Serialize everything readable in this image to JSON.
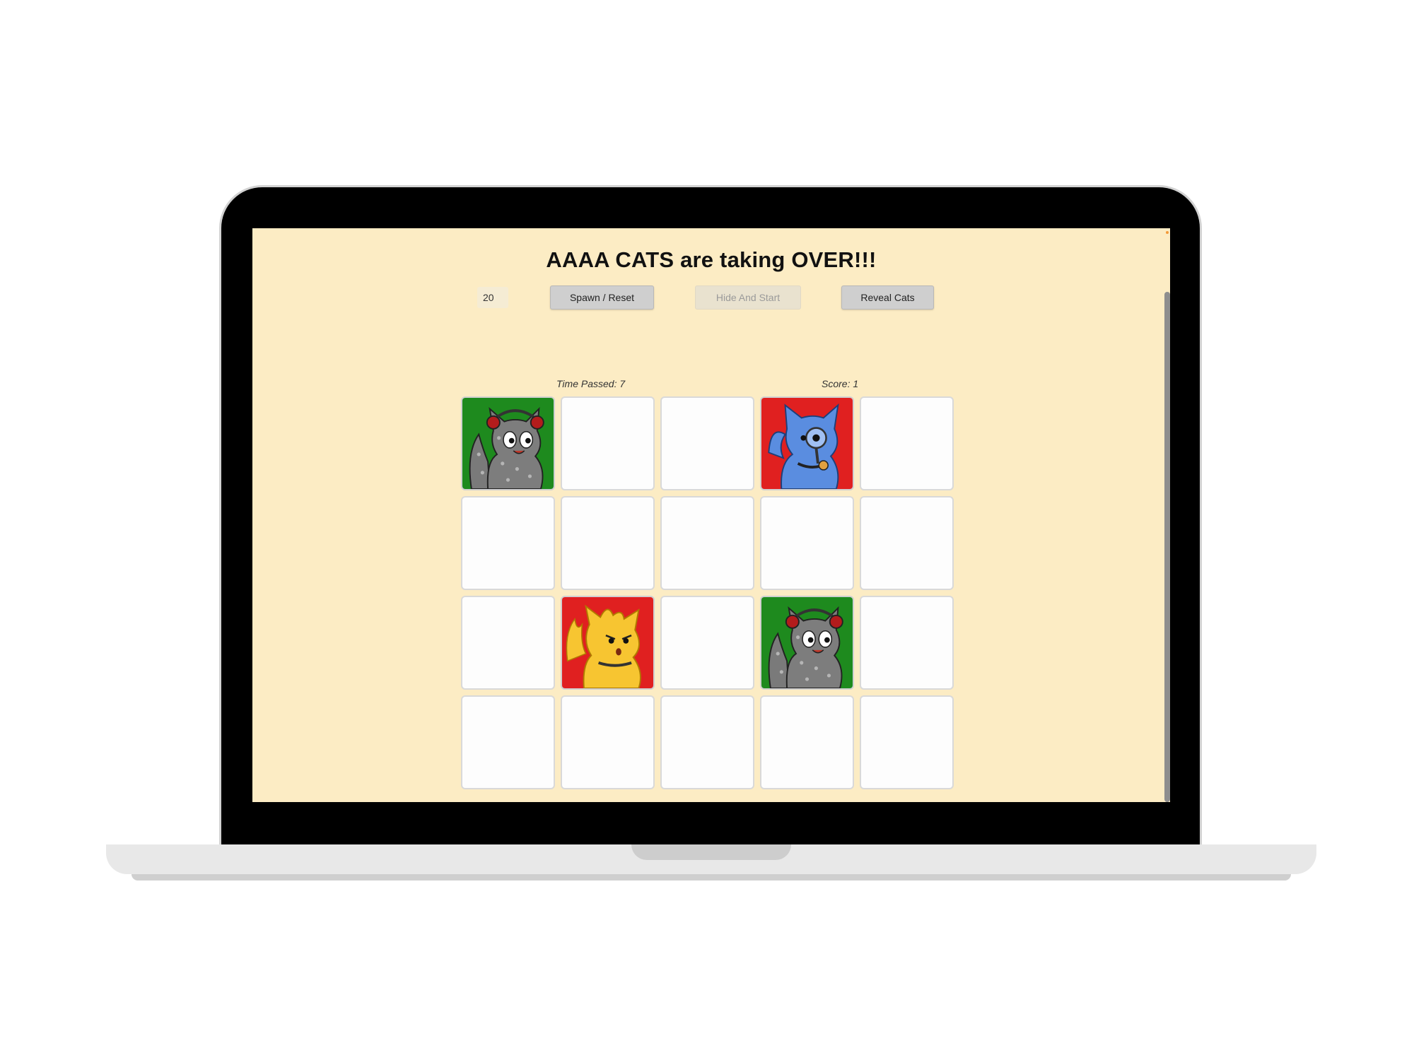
{
  "app": {
    "title": "AAAA CATS are taking OVER!!!",
    "count_value": "20",
    "buttons": {
      "spawn": "Spawn / Reset",
      "hide": "Hide And Start",
      "reveal": "Reveal Cats"
    },
    "time_label": "Time Passed: 7",
    "score_label": "Score: 1"
  },
  "grid": {
    "rows": 4,
    "cols": 5,
    "cells": [
      {
        "cat": "gray-headphones-cat",
        "bg": "#1e8a1e"
      },
      {
        "cat": null
      },
      {
        "cat": null
      },
      {
        "cat": "blue-magnifier-cat",
        "bg": "#e02020"
      },
      {
        "cat": null
      },
      {
        "cat": null
      },
      {
        "cat": null
      },
      {
        "cat": null
      },
      {
        "cat": null
      },
      {
        "cat": null
      },
      {
        "cat": null
      },
      {
        "cat": "yellow-flame-cat",
        "bg": "#e02020"
      },
      {
        "cat": null
      },
      {
        "cat": "gray-headphones-cat",
        "bg": "#1e8a1e"
      },
      {
        "cat": null
      },
      {
        "cat": null
      },
      {
        "cat": null
      },
      {
        "cat": null
      },
      {
        "cat": null
      },
      {
        "cat": null
      }
    ]
  },
  "colors": {
    "page_background": "#fcecc4",
    "button": "#cfcfcf",
    "disabled_button": "#e9e2cf",
    "cell": "#fdfdfd"
  }
}
